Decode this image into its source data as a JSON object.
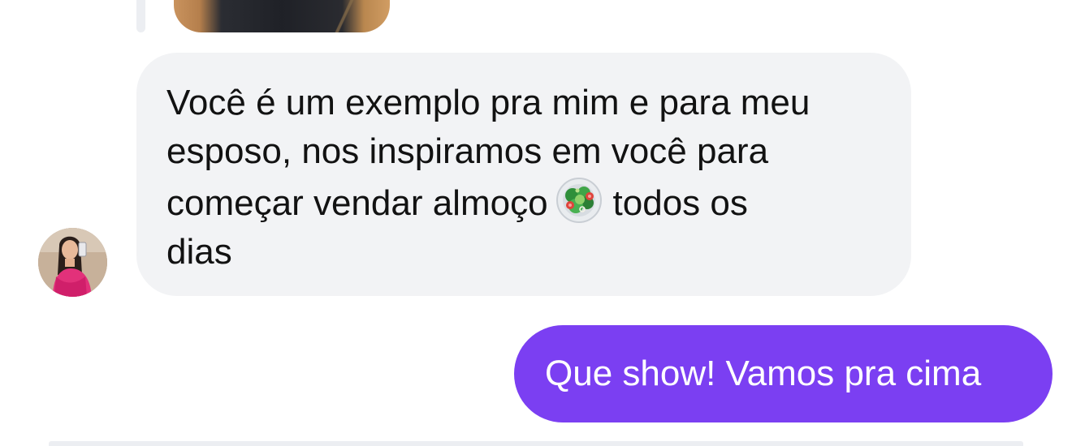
{
  "colors": {
    "incoming_bubble": "#f2f3f5",
    "outgoing_bubble": "#7b3ff2",
    "incoming_text": "#121212",
    "outgoing_text": "#ffffff"
  },
  "messages": [
    {
      "direction": "incoming",
      "text_before_emoji": "Você é um exemplo pra mim e para meu\nesposo, nos inspiramos em você para\ncomeçar vendar almoço",
      "emoji": "salad-emoji",
      "text_after_emoji": "todos os\ndias"
    },
    {
      "direction": "outgoing",
      "text": "Que show! Vamos pra cima"
    }
  ],
  "icons": {
    "salad": "salad-emoji",
    "avatar": "contact-avatar"
  }
}
